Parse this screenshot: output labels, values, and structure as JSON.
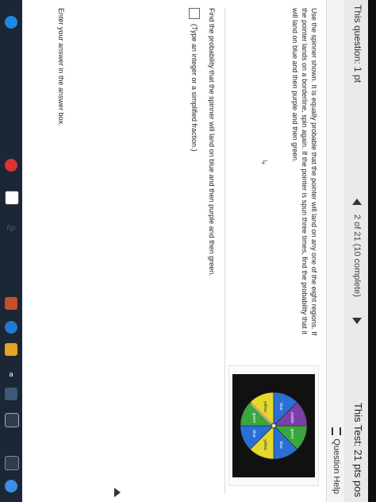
{
  "header": {
    "question_label": "This question: 1 pt",
    "progress": "2 of 21 (10 complete)",
    "test_label": "This Test: 21 pts pos"
  },
  "help": {
    "label": "Question Help"
  },
  "problem": {
    "text": "Use the spinner shown. It is equally probable that the pointer will land on any one of the eight regions. If the pointer lands on a borderline, spin again. If the pointer is spun three times, find the probability that it will land on blue and then purple and then green."
  },
  "spinner": {
    "labels": [
      "green",
      "blue",
      "yellow",
      "blue",
      "green",
      "yellow",
      "blue",
      "purple"
    ],
    "colors": {
      "green": "#3aa640",
      "blue": "#2a6fd6",
      "yellow": "#e4d82b",
      "purple": "#7b3fa8",
      "pointer": "#d8a472",
      "frame": "#111111"
    }
  },
  "question": {
    "find": "Find the probability that the spinner will land on blue and then purple and then green.",
    "instruction": "(Type an integer or a simplified fraction.)",
    "enter": "Enter your answer in the answer box."
  },
  "taskbar": {
    "icons": [
      "windows-icon",
      "search-icon",
      "task-view-icon",
      "store-icon",
      "mail-icon",
      "edge-icon",
      "powerpoint-icon",
      "chrome-icon",
      "settings-icon"
    ],
    "amazon_label": "a",
    "brand": "hp"
  }
}
